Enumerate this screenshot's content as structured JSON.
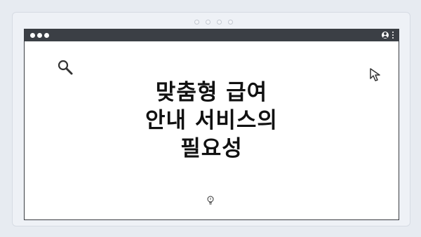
{
  "window": {
    "title_lines": [
      "맞춤형 급여",
      "안내 서비스의",
      "필요성"
    ]
  },
  "icons": {
    "search": "search-icon",
    "cursor": "cursor-arrow-icon",
    "bulb": "lightbulb-icon",
    "user": "user-icon",
    "menu": "kebab-menu-icon"
  },
  "colors": {
    "titlebar": "#3b3f45",
    "background": "#e7ebf1",
    "text": "#111111"
  }
}
